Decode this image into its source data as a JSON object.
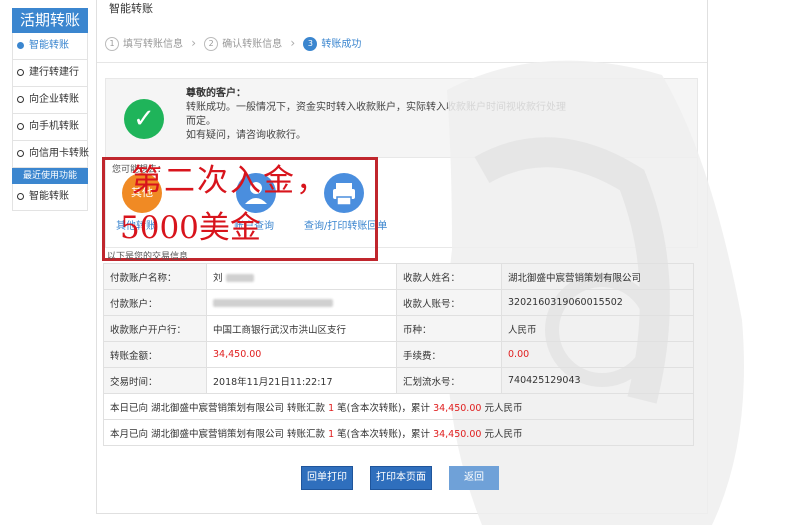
{
  "sidebar": {
    "title": "活期转账",
    "items": [
      {
        "label": "智能转账"
      },
      {
        "label": "建行转建行"
      },
      {
        "label": "向企业转账"
      },
      {
        "label": "向手机转账"
      },
      {
        "label": "向信用卡转账"
      }
    ],
    "recent_label": "最近使用功能",
    "recent_items": [
      {
        "label": "智能转账"
      }
    ]
  },
  "main": {
    "title": "智能转账",
    "steps": [
      {
        "num": "1",
        "label": "填写转账信息"
      },
      {
        "num": "2",
        "label": "确认转账信息"
      },
      {
        "num": "3",
        "label": "转账成功"
      }
    ],
    "success": {
      "greeting": "尊敬的客户：",
      "line1": "转账成功。一般情况下，资金实时转入收款账户，实际转入收款账户时间视收款行处理而定。",
      "line2": "如有疑问，请咨询收款行。"
    },
    "want_label": "您可能想去：",
    "quick_links": [
      {
        "label": "其他转账",
        "icon_text": "其他"
      },
      {
        "label": "账户查询"
      },
      {
        "label": "查询/打印转账回单"
      }
    ],
    "info_label": "以下是您的交易信息",
    "rows": [
      [
        "付款账户名称：",
        "刘",
        "收款人姓名：",
        "湖北御盛中宸营销策划有限公司"
      ],
      [
        "付款账户：",
        "",
        "收款人账号：",
        "3202160319060015502"
      ],
      [
        "收款账户开户行：",
        "中国工商银行武汉市洪山区支行",
        "币种：",
        "人民币"
      ],
      [
        "转账金额：",
        "34,450.00",
        "手续费：",
        "0.00"
      ],
      [
        "交易时间：",
        "2018年11月21日11:22:17",
        "汇划流水号：",
        "740425129043"
      ]
    ],
    "summary_day": {
      "prefix": "本日已向 湖北御盛中宸营销策划有限公司 转账汇款 ",
      "count": "1",
      "mid": " 笔(含本次转账)，累计 ",
      "amount": "34,450.00",
      "suffix": " 元人民币"
    },
    "summary_month": {
      "prefix": "本月已向 湖北御盛中宸营销策划有限公司 转账汇款 ",
      "count": "1",
      "mid": " 笔(含本次转账)，累计 ",
      "amount": "34,450.00",
      "suffix": " 元人民币"
    },
    "buttons": {
      "print_receipt": "回单打印",
      "print_page": "打印本页面",
      "back": "返回"
    }
  },
  "overlay": {
    "line1": "第二次入金，",
    "line2": "5000美金"
  },
  "watermark": {
    "text": "气功"
  },
  "colors": {
    "primary": "#3b86cf",
    "success": "#1fb45a",
    "alert": "#e02020"
  }
}
